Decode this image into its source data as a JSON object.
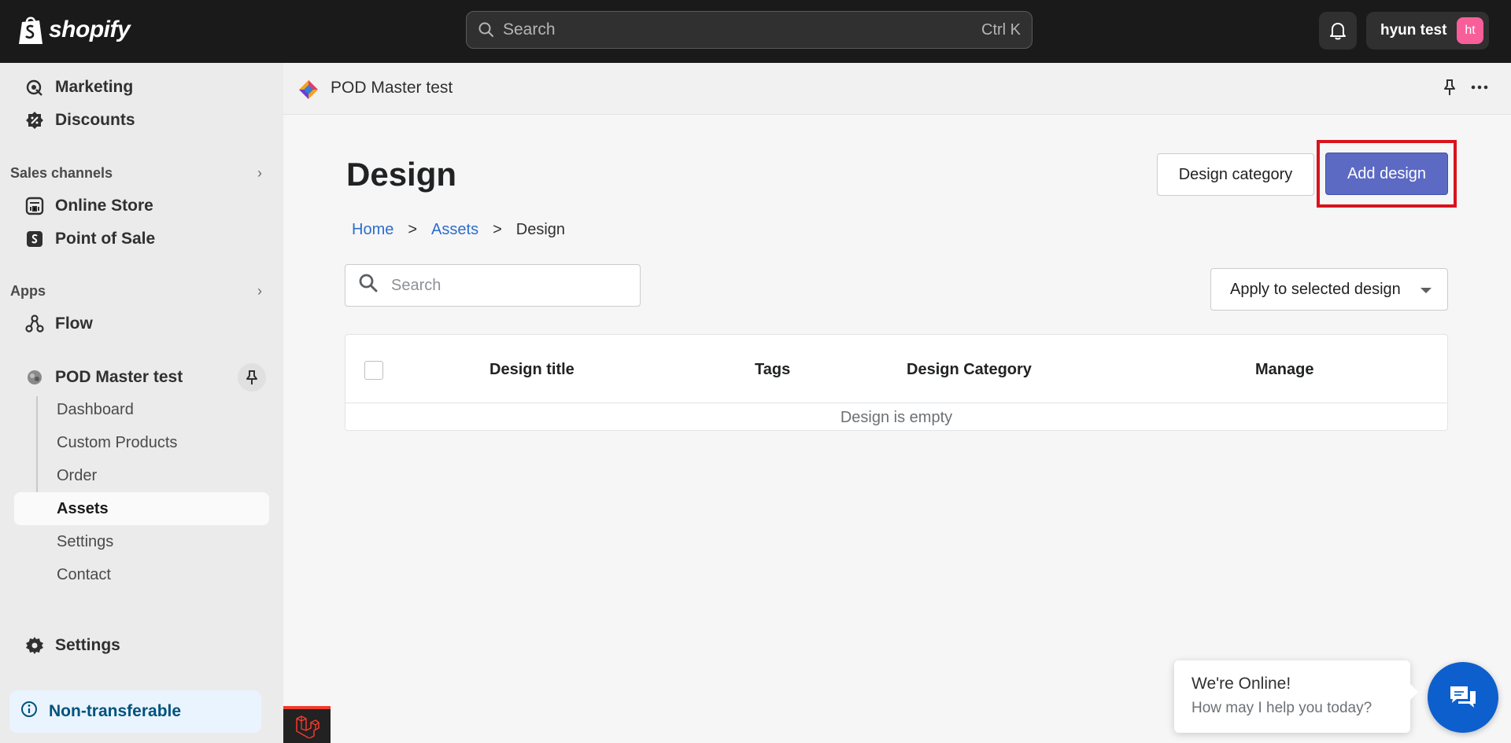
{
  "topbar": {
    "brand": "shopify",
    "search_placeholder": "Search",
    "search_shortcut": "Ctrl K",
    "user_name": "hyun test",
    "user_initials": "ht"
  },
  "sidebar": {
    "items": [
      {
        "label": "Marketing",
        "icon": "marketing-icon"
      },
      {
        "label": "Discounts",
        "icon": "discount-icon"
      }
    ],
    "sales_channels_label": "Sales channels",
    "sales_channels": [
      {
        "label": "Online Store",
        "icon": "store-icon"
      },
      {
        "label": "Point of Sale",
        "icon": "pos-icon"
      }
    ],
    "apps_label": "Apps",
    "apps": [
      {
        "label": "Flow",
        "icon": "flow-icon"
      },
      {
        "label": "POD Master test",
        "icon": "app-icon"
      }
    ],
    "app_subitems": [
      "Dashboard",
      "Custom Products",
      "Order",
      "Assets",
      "Settings",
      "Contact"
    ],
    "active_subitem": "Assets",
    "settings_label": "Settings",
    "non_transferable_label": "Non-transferable"
  },
  "appbar": {
    "app_name": "POD Master test"
  },
  "page": {
    "title": "Design",
    "design_category_button": "Design category",
    "add_design_button": "Add design",
    "breadcrumb": {
      "home": "Home",
      "sep1": ">",
      "assets": "Assets",
      "sep2": ">",
      "current": "Design"
    },
    "search_placeholder": "Search",
    "bulk_action_label": "Apply to selected design",
    "table": {
      "columns": [
        "Design title",
        "Tags",
        "Design Category",
        "Manage"
      ],
      "empty_message": "Design is empty"
    }
  },
  "chat": {
    "title": "We're Online!",
    "subtitle": "How may I help you today?"
  },
  "colors": {
    "primary": "#5c6ac4",
    "highlight": "#d8131e",
    "link": "#2c6ecb",
    "chat": "#0d5fce"
  }
}
